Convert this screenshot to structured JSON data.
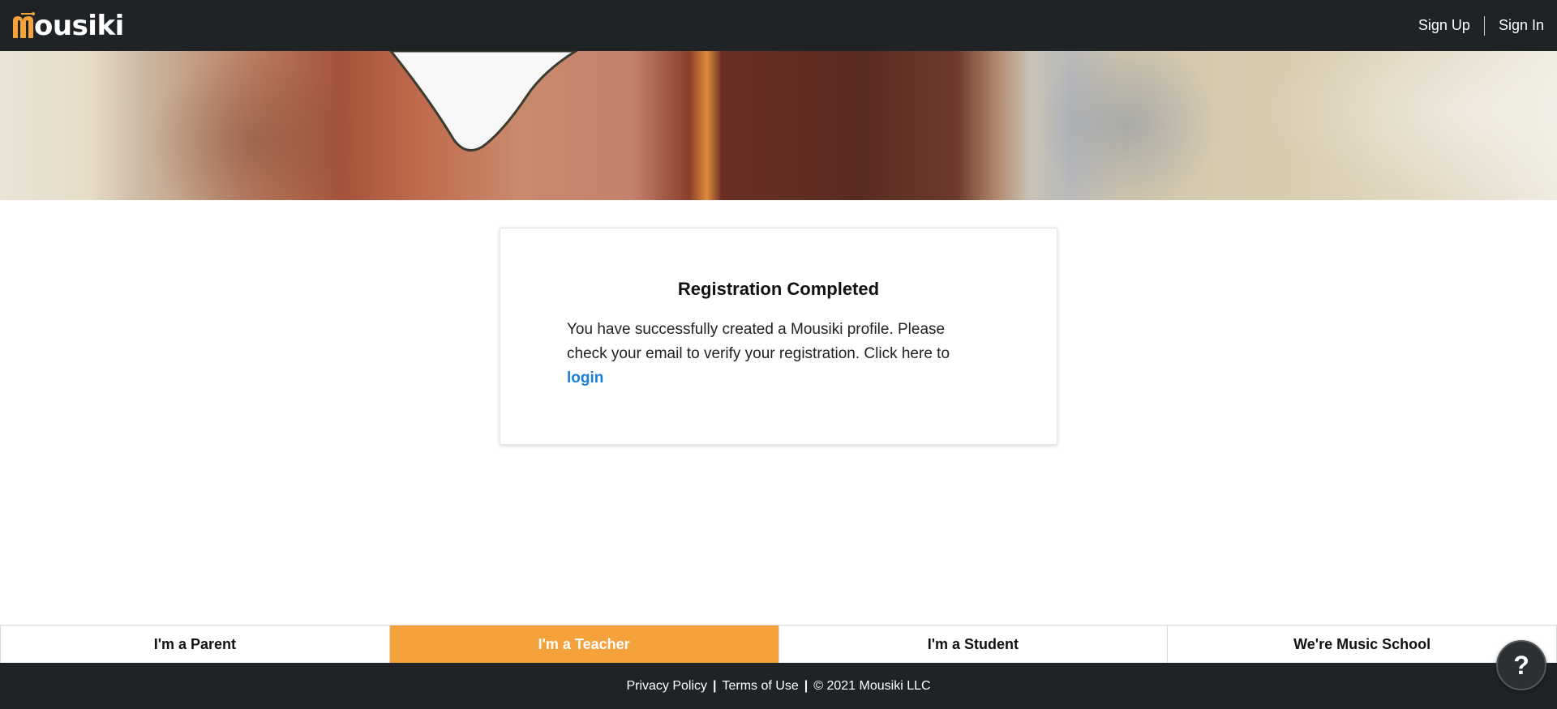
{
  "header": {
    "logo_text": "ousiki",
    "sign_up": "Sign Up",
    "sign_in": "Sign In"
  },
  "card": {
    "title": "Registration Completed",
    "message": "You have successfully created a Mousiki profile. Please check your email to verify your registration. Click here to ",
    "login_link": "login"
  },
  "roles": [
    {
      "label": "I'm a Parent",
      "active": false
    },
    {
      "label": "I'm a Teacher",
      "active": true
    },
    {
      "label": "I'm a Student",
      "active": false
    },
    {
      "label": "We're Music School",
      "active": false
    }
  ],
  "footer": {
    "privacy": "Privacy Policy",
    "terms": "Terms of Use",
    "copyright": "© 2021 Mousiki LLC",
    "separator": "|"
  },
  "help": {
    "symbol": "?"
  },
  "icons": {
    "logo": "guitar-m-logo-icon",
    "help": "question-mark-icon"
  },
  "colors": {
    "brand_orange": "#f5a13c",
    "dark_bar": "#1f2326",
    "link_blue": "#1a80d9"
  }
}
